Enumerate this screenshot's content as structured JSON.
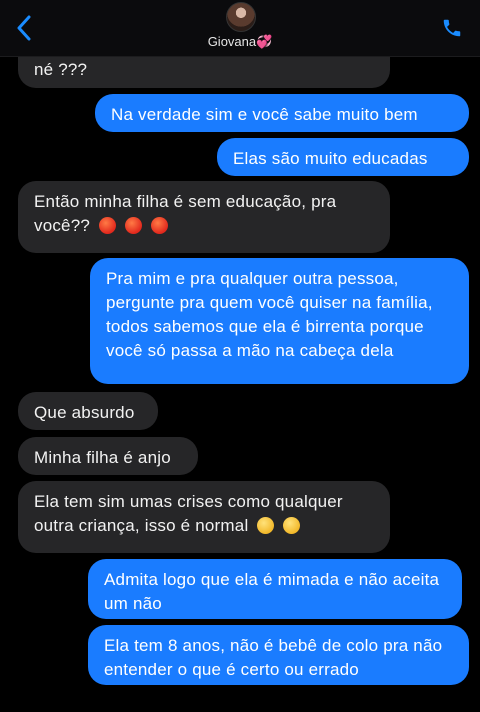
{
  "header": {
    "contact_name": "Giovana💞"
  },
  "messages": [
    {
      "from": "in",
      "text": "né ???"
    },
    {
      "from": "out",
      "text": "Na verdade sim e você sabe muito bem"
    },
    {
      "from": "out",
      "text": "Elas são muito educadas"
    },
    {
      "from": "in",
      "text": "Então minha filha é sem educação, pra você??",
      "emoji": [
        "angry-face",
        "angry-face",
        "angry-face"
      ]
    },
    {
      "from": "out",
      "text": "Pra mim e pra qualquer outra pessoa, pergunte pra quem você quiser na família, todos sabemos que ela é birrenta porque você só passa a mão na cabeça dela"
    },
    {
      "from": "in",
      "text": "Que absurdo"
    },
    {
      "from": "in",
      "text": "Minha filha é anjo"
    },
    {
      "from": "in",
      "text": "Ela tem sim umas crises como qualquer outra criança, isso é normal",
      "emoji": [
        "flushed-face",
        "flushed-face"
      ]
    },
    {
      "from": "out",
      "text": "Admita logo que ela é mimada e não aceita um não"
    },
    {
      "from": "out",
      "text": "Ela tem 8 anos, não é bebê de colo pra não entender o que é certo ou errado"
    }
  ],
  "colors": {
    "incoming_bubble": "#262628",
    "outgoing_bubble": "#1a7cff",
    "accent": "#1a8cff"
  }
}
